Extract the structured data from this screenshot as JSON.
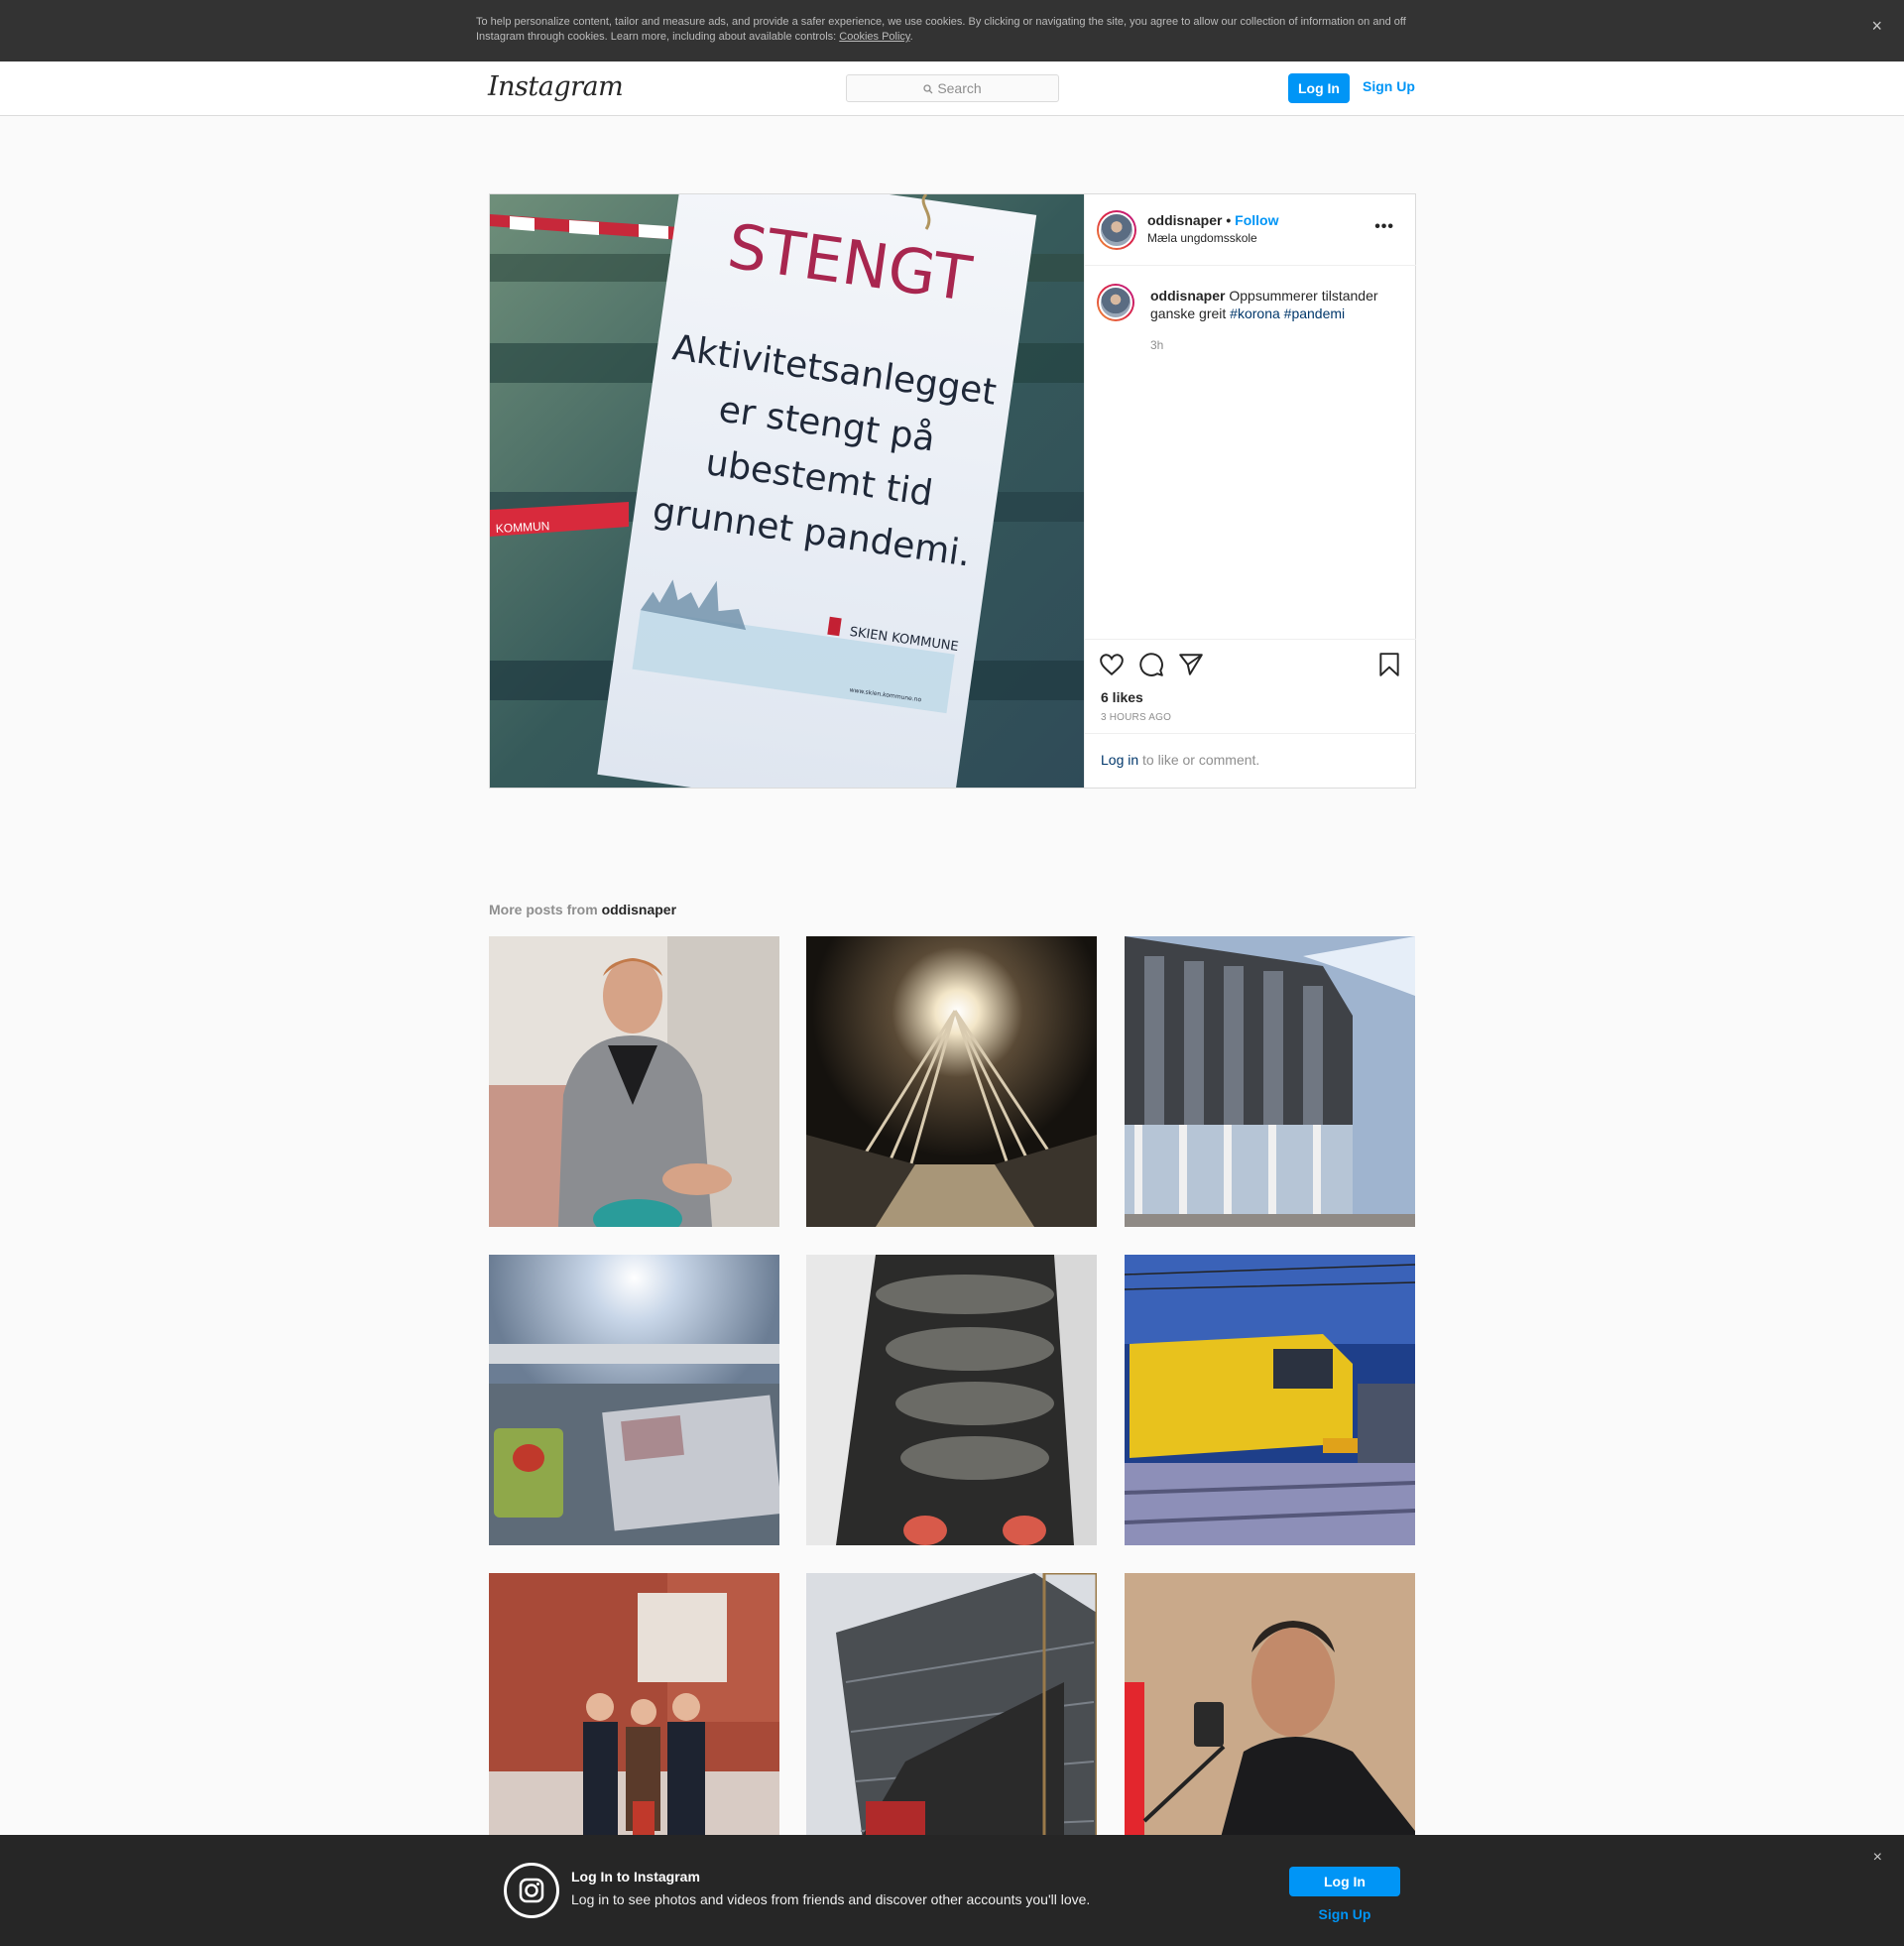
{
  "cookie_banner": {
    "text": "To help personalize content, tailor and measure ads, and provide a safer experience, we use cookies. By clicking or navigating the site, you agree to allow our collection of information on and off Instagram through cookies. Learn more, including about available controls: ",
    "link": "Cookies Policy",
    "period": ".",
    "close": "×"
  },
  "nav": {
    "logo": "Instagram",
    "search_placeholder": "Search",
    "login": "Log In",
    "signup": "Sign Up"
  },
  "post": {
    "image_sign": {
      "title": "STENGT",
      "lines": [
        "Aktivitetsanlegget",
        "er stengt på",
        "ubestemt tid",
        "grunnet pandemi."
      ],
      "org": "SKIEN KOMMUNE",
      "url": "www.skien.kommune.no",
      "tape_text": "KOMMUN"
    },
    "username": "oddisnaper",
    "dot": "•",
    "follow": "Follow",
    "location": "Mæla ungdomsskole",
    "more": "•••",
    "caption_text": "Oppsummerer tilstander ganske greit",
    "hashtags": [
      "#korona",
      "#pandemi"
    ],
    "caption_time": "3h",
    "likes": "6 likes",
    "time_ago": "3 HOURS AGO",
    "login_link": "Log in",
    "login_suffix": " to like or comment."
  },
  "more_posts": {
    "prefix": "More posts from ",
    "username": "oddisnaper"
  },
  "bottom_bar": {
    "title": "Log In to Instagram",
    "subtitle": "Log in to see photos and videos from friends and discover other accounts you'll love.",
    "login": "Log In",
    "signup": "Sign Up",
    "close": "×"
  },
  "colors": {
    "accent": "#0095f6",
    "link_dark": "#00376b",
    "banner_bg": "#333333",
    "sign_red": "#a8264f"
  }
}
